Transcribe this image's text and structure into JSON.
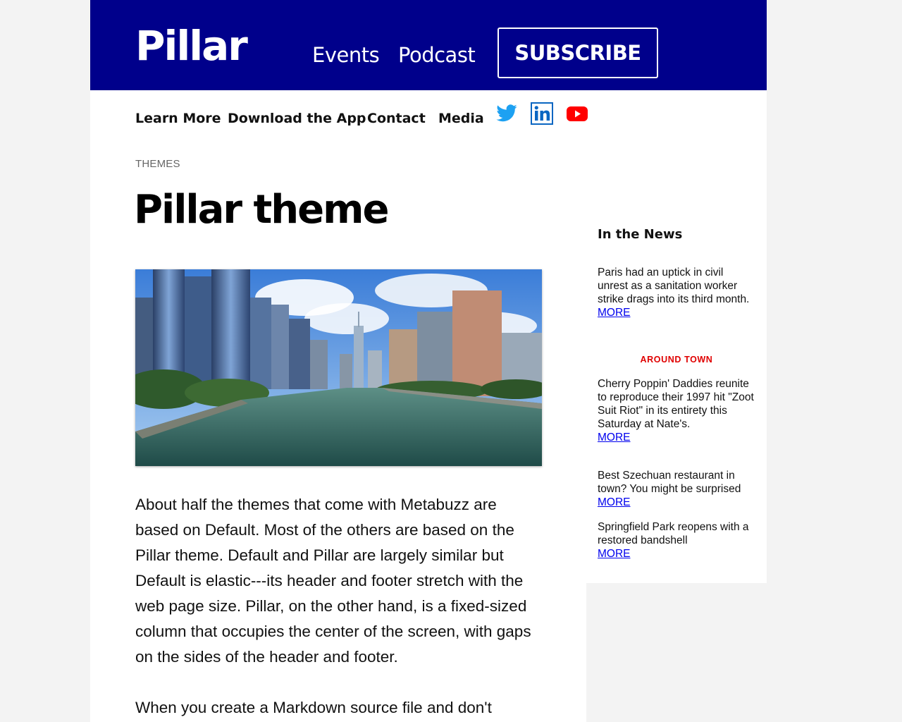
{
  "header": {
    "logo": "Pillar",
    "nav": [
      "Events",
      "Podcast"
    ],
    "subscribe_label": "SUBSCRIBE"
  },
  "secondary_nav": {
    "items": [
      "Learn More",
      "Download the App",
      "Contact",
      "Media"
    ],
    "social": [
      "twitter-icon",
      "linkedin-icon",
      "youtube-icon"
    ]
  },
  "article": {
    "kicker": "THEMES",
    "title": "Pillar theme",
    "paragraph1": "About half the themes that come with Metabuzz are based on Default. Most of the others are based on the Pillar theme. Default and Pillar are largely similar but Default is elastic---its header and footer stretch with the web page size. Pillar, on the other hand, is a fixed-sized column that occupies the center of the screen, with gaps on the sides of the header and footer.",
    "paragraph2": "When you create a Markdown source file and don't"
  },
  "sidebar": {
    "title": "In the News",
    "section_label": "AROUND TOWN",
    "more_label": "MORE",
    "items": [
      {
        "text": "Paris had an uptick in civil unrest as a sanitation worker strike drags into its third month."
      },
      {
        "text": "Cherry Poppin' Daddies reunite to reproduce their 1997 hit \"Zoot Suit Riot\" in its entirety this Saturday at Nate's."
      },
      {
        "text": "Best Szechuan restaurant in town? You might be surprised"
      },
      {
        "text": "Springfield Park reopens with a restored bandshell"
      }
    ]
  },
  "colors": {
    "header_bg": "#00008b",
    "section_label": "#e00000",
    "link": "#0000ee"
  }
}
